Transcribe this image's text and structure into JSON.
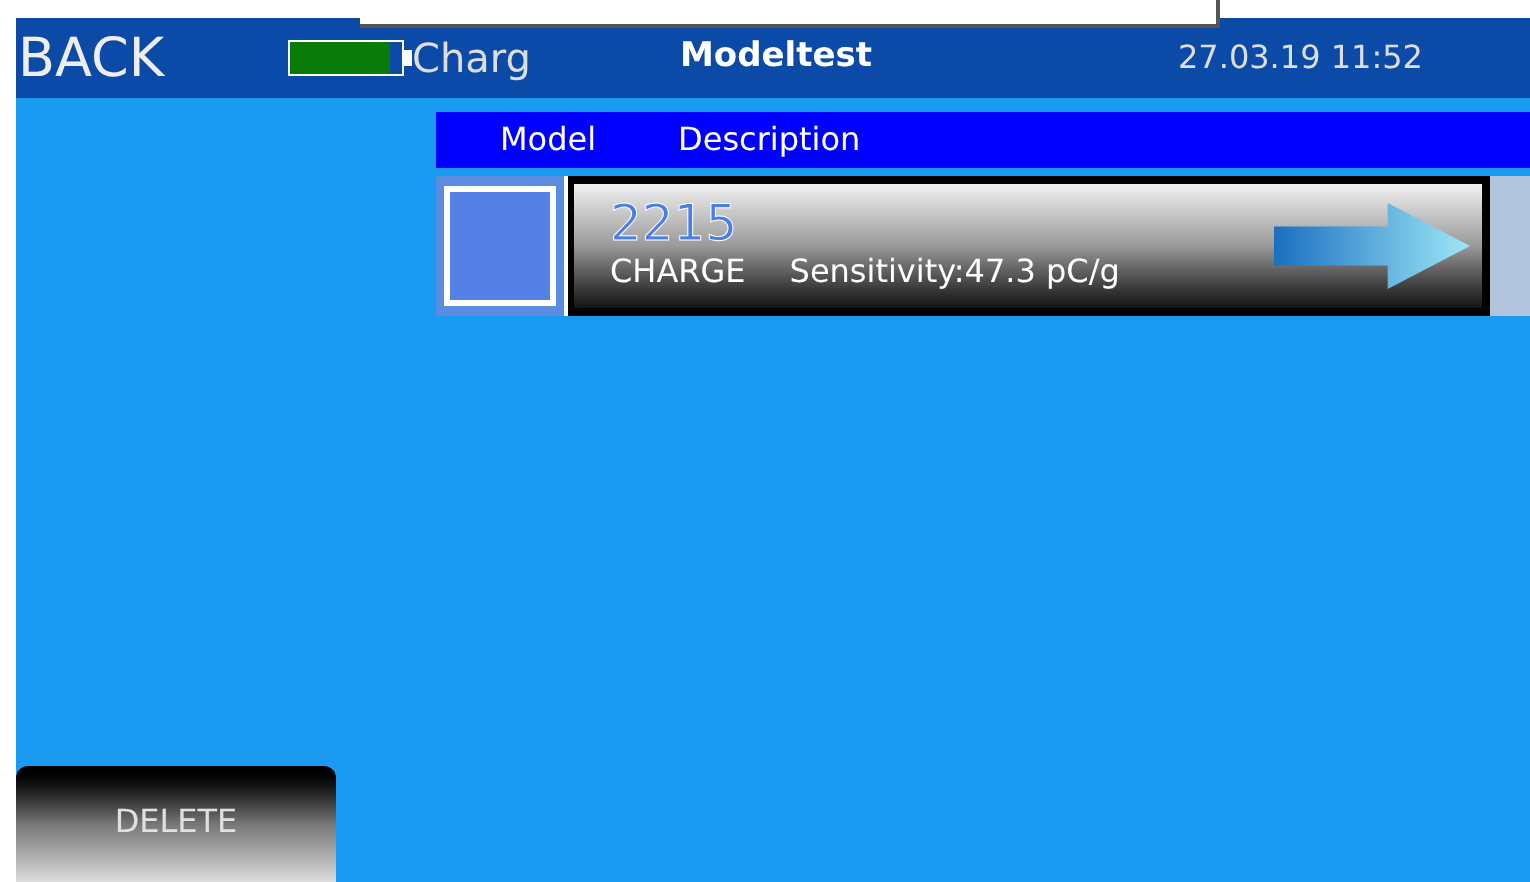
{
  "header": {
    "back": "BACK",
    "battery": {
      "level": 0.9,
      "label": "Charg"
    },
    "title": "Modeltest",
    "datetime": "27.03.19 11:52"
  },
  "table": {
    "columns": [
      "Model",
      "Description"
    ],
    "rows": [
      {
        "selected": false,
        "model": "2215",
        "type": "CHARGE",
        "description": "Sensitivity:47.3 pC/g"
      }
    ]
  },
  "buttons": [
    "DELETE"
  ]
}
